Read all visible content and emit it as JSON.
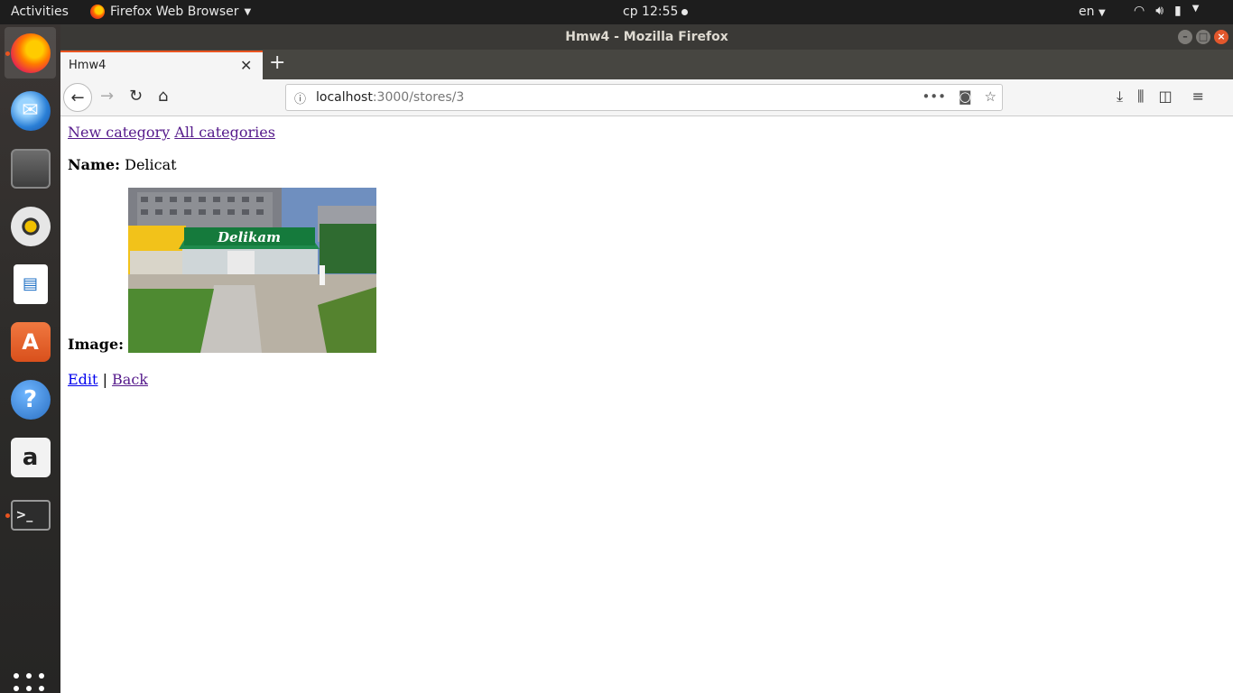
{
  "system": {
    "activities": "Activities",
    "app_menu": "Firefox Web Browser",
    "clock": "ср 12:55",
    "language": "en"
  },
  "window": {
    "title": "Hmw4 - Mozilla Firefox"
  },
  "browser": {
    "tab_title": "Hmw4",
    "url_host": "localhost",
    "url_path": ":3000/stores/3"
  },
  "page": {
    "links": {
      "new_category": "New category",
      "all_categories": "All categories"
    },
    "name_label": "Name:",
    "name_value": "Delicat",
    "image_label": "Image:",
    "sign_text": "Delikam",
    "edit_link": "Edit",
    "separator": "|",
    "back_link": "Back"
  },
  "dock": [
    "firefox-icon",
    "thunderbird-icon",
    "files-icon",
    "rhythmbox-icon",
    "libreoffice-writer-icon",
    "ubuntu-software-icon",
    "help-icon",
    "amazon-icon",
    "terminal-icon",
    "show-applications-icon"
  ]
}
